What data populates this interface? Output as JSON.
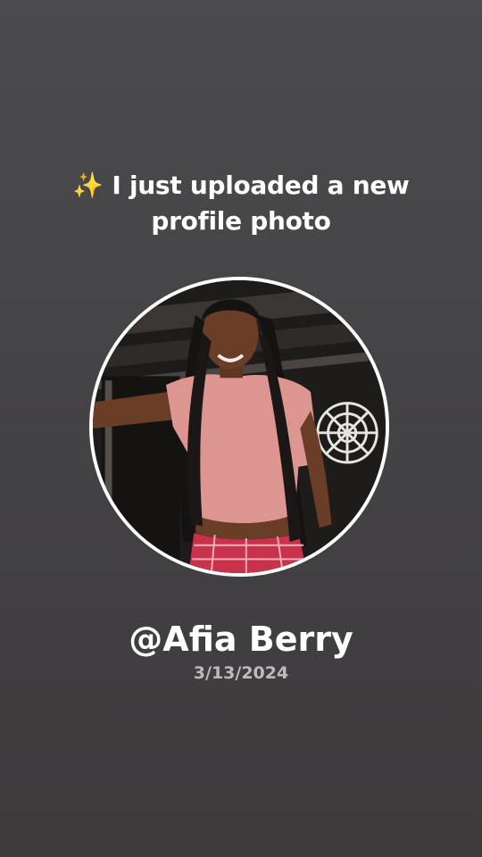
{
  "announcement": {
    "emoji": "✨",
    "text": "I just uploaded a new profile photo"
  },
  "profile": {
    "photo_icon": "profile-photo",
    "username": "@Afia Berry",
    "date": "3/13/2024"
  },
  "colors": {
    "background": "#444345",
    "text": "#ffffff",
    "date_text": "#bdbcbd",
    "ring": "#ffffff"
  }
}
